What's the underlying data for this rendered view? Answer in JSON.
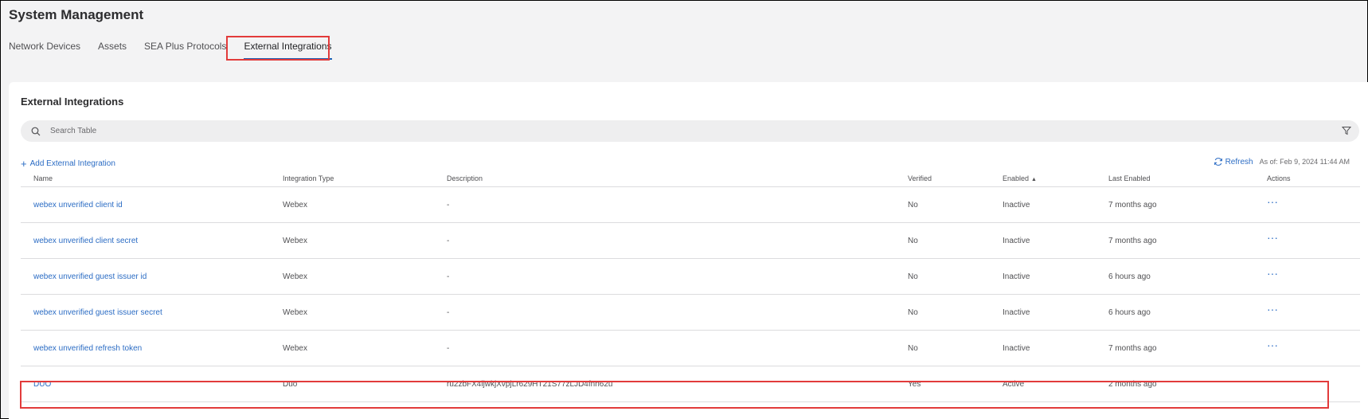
{
  "page_title": "System Management",
  "tabs": [
    {
      "label": "Network Devices"
    },
    {
      "label": "Assets"
    },
    {
      "label": "SEA Plus Protocols"
    },
    {
      "label": "External Integrations"
    }
  ],
  "active_tab": "External Integrations",
  "card": {
    "title": "External Integrations",
    "search_placeholder": "Search Table",
    "add_label": "Add External Integration",
    "refresh_label": "Refresh",
    "as_of": "As of: Feb 9, 2024 11:44 AM"
  },
  "table": {
    "columns": {
      "name": "Name",
      "type": "Integration Type",
      "description": "Description",
      "verified": "Verified",
      "enabled": "Enabled",
      "last_enabled": "Last Enabled",
      "actions": "Actions"
    },
    "rows": [
      {
        "name": "webex unverified client id",
        "type": "Webex",
        "description": "-",
        "verified": "No",
        "enabled": "Inactive",
        "last_enabled": "7 months ago",
        "actions": "···"
      },
      {
        "name": "webex unverified client secret",
        "type": "Webex",
        "description": "-",
        "verified": "No",
        "enabled": "Inactive",
        "last_enabled": "7 months ago",
        "actions": "···"
      },
      {
        "name": "webex unverified guest issuer id",
        "type": "Webex",
        "description": "-",
        "verified": "No",
        "enabled": "Inactive",
        "last_enabled": "6 hours ago",
        "actions": "···"
      },
      {
        "name": "webex unverified guest issuer secret",
        "type": "Webex",
        "description": "-",
        "verified": "No",
        "enabled": "Inactive",
        "last_enabled": "6 hours ago",
        "actions": "···"
      },
      {
        "name": "webex unverified refresh token",
        "type": "Webex",
        "description": "-",
        "verified": "No",
        "enabled": "Inactive",
        "last_enabled": "7 months ago",
        "actions": "···"
      },
      {
        "name": "DUO",
        "type": "Duo",
        "description": "ru2zbFX4ljwkjXvpjLr629HT21S77zLJD4fnn62u",
        "verified": "Yes",
        "enabled": "Active",
        "last_enabled": "2 months ago",
        "actions": "···"
      }
    ]
  },
  "colors": {
    "accent": "#2b6cc4",
    "highlight": "#e23b3b",
    "tab_underline": "#1f5fb3"
  }
}
